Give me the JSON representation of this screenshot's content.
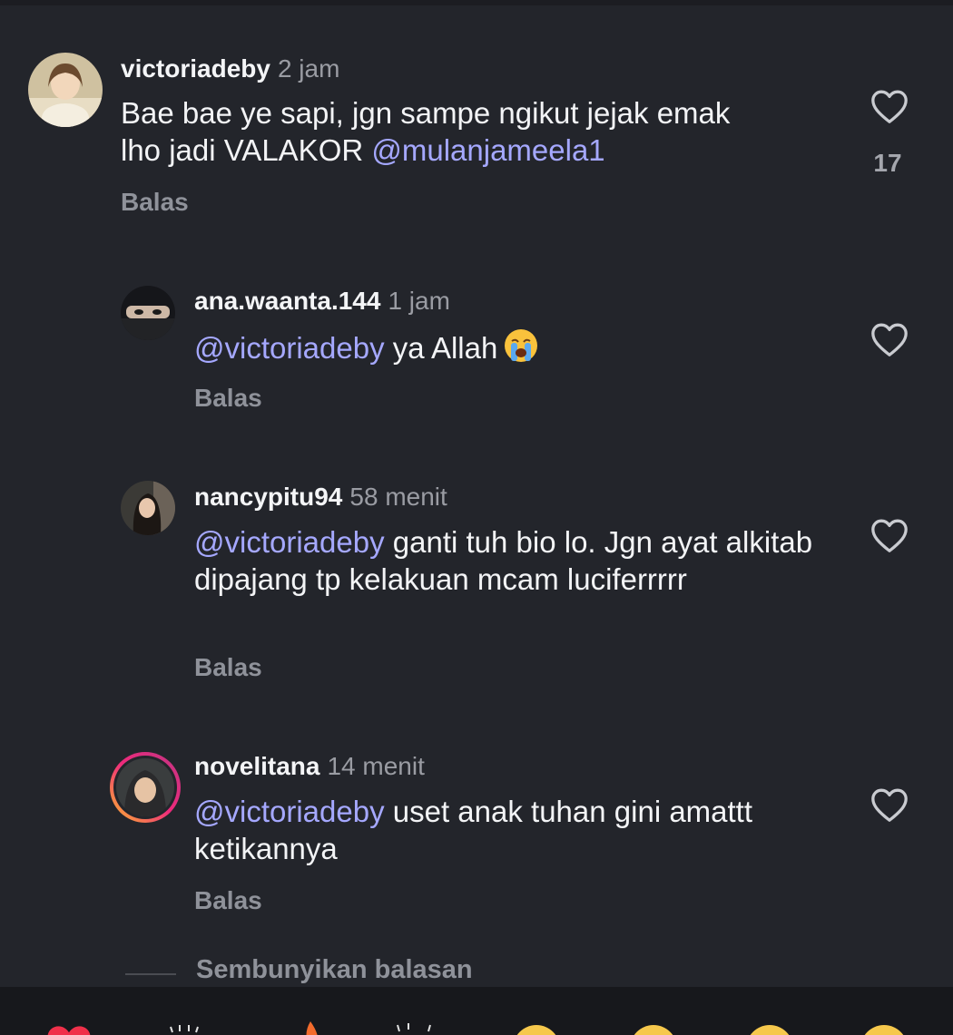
{
  "comments": [
    {
      "username": "victoriadeby",
      "time": "2 jam",
      "text_plain": "Bae bae ye sapi, jgn sampe ngikut jejak emak lho jadi VALAKOR ",
      "mention_after": "@mulanjameela1",
      "likes": "17",
      "reply_label": "Balas"
    },
    {
      "username": "ana.waanta.144",
      "time": "1 jam",
      "mention": "@victoriadeby",
      "text": " ya Allah",
      "emoji": "loudly-crying-face",
      "reply_label": "Balas"
    },
    {
      "username": "nancypitu94",
      "time": "58 menit",
      "mention": "@victoriadeby",
      "text": " ganti tuh bio lo. Jgn ayat alkitab dipajang tp kelakuan mcam luciferrrrr",
      "reply_label": "Balas"
    },
    {
      "username": "novelitana",
      "time": "14 menit",
      "mention": "@victoriadeby",
      "text": " uset anak tuhan gini amattt ketikannya",
      "reply_label": "Balas",
      "story_ring": true
    }
  ],
  "hide_replies_label": "Sembunyikan balasan",
  "icons": {
    "like": "heart-outline-icon",
    "reactions": [
      "red-heart-icon",
      "raising-hands-icon",
      "fire-icon",
      "clapping-hands-icon",
      "crying-face-icon",
      "heart-eyes-icon",
      "surprised-face-icon",
      "tears-of-joy-icon"
    ]
  },
  "colors": {
    "background": "#23252b",
    "mention": "#a5a8ff",
    "secondary_text": "#9a9ca3"
  }
}
